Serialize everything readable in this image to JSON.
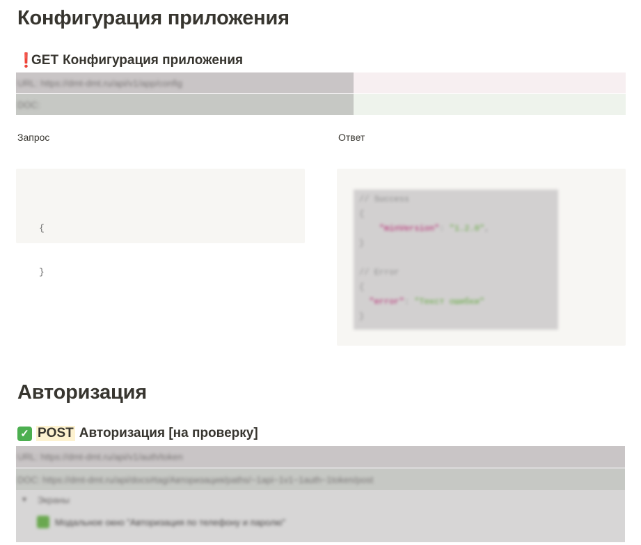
{
  "section1": {
    "title": "Конфигурация приложения",
    "endpoint": {
      "icon": "exclamation-icon",
      "method": "GET",
      "name": "Конфигурация приложения",
      "url_row": "URL: https://dmt-dmt.ru/api/v1/app/config",
      "doc_row": "DOC:"
    },
    "request_label": "Запрос",
    "response_label": "Ответ",
    "request_code": [
      "{",
      "}"
    ],
    "response_code": {
      "success_comment": "// Success",
      "open1": "{",
      "key1": "\"minVersion\"",
      "val1": "\"1.2.0\"",
      "close1": "}",
      "error_comment": "// Error",
      "open2": "{",
      "key2": "\"error\"",
      "val2": "\"Текст ошибки\"",
      "close2": "}"
    }
  },
  "section2": {
    "title": "Авторизация",
    "endpoint": {
      "icon": "checkmark-icon",
      "method": "POST",
      "name": "Авторизация [на проверку]",
      "url_row": "URL: https://dmt-dmt.ru/api/v1/auth/token",
      "doc_row": "DOC: https://dmt-dmt.ru/api/docs#tag/Авторизация/paths/~1api~1v1~1auth~1token/post",
      "toggle_label": "Экраны",
      "screen_item": "Модальное окно \"Авторизация по телефону и паролю\""
    }
  },
  "colors": {
    "url_row_bg": "#f7eff1",
    "doc_row_bg": "#eef3ec",
    "code_bg": "#f7f6f3",
    "blur_overlay": "#c7c3c3"
  }
}
